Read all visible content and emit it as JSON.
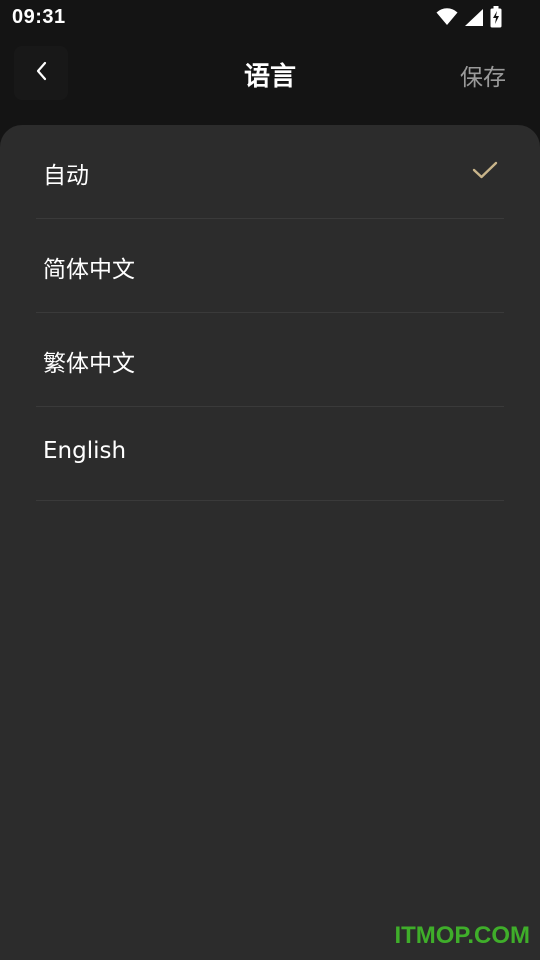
{
  "status_bar": {
    "time": "09:31",
    "icons": [
      "wifi-icon",
      "signal-icon",
      "battery-charging-icon"
    ]
  },
  "header": {
    "back_icon": "chevron-left-icon",
    "title": "语言",
    "save_label": "保存"
  },
  "languages": {
    "items": [
      {
        "label": "自动",
        "selected": true
      },
      {
        "label": "简体中文",
        "selected": false
      },
      {
        "label": "繁体中文",
        "selected": false
      },
      {
        "label": "English",
        "selected": false
      }
    ],
    "check_icon": "checkmark-icon"
  },
  "colors": {
    "background": "#141414",
    "sheet": "#2c2c2c",
    "divider": "#3a3a3a",
    "accent_check": "#c8b48a",
    "save_text": "#9a9a9a",
    "watermark": "#3fae2a"
  },
  "watermark": {
    "text": "ITMOP.COM"
  }
}
